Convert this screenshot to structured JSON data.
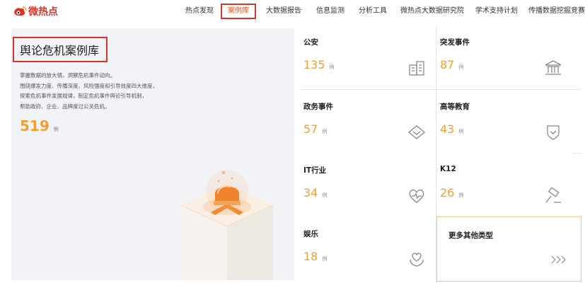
{
  "header": {
    "logo_text": "微热点",
    "nav": [
      "热点发现",
      "案例库",
      "大数据报告",
      "信息监测",
      "分析工具",
      "微热点大数据研究院",
      "学术支持计划",
      "传播数据挖掘竞赛"
    ],
    "active_index": 1
  },
  "left": {
    "title": "舆论危机案例库",
    "desc": [
      "掌握数据的放大镜，洞察危机事件动向。",
      "围绕爆发力度、传播深度、风险强度和引导效度四大维度，",
      "探索危机事件发展规律，制定危机事件舆论引导机制，",
      "帮助政府、企业、品牌度过公关危机。"
    ],
    "total": "519",
    "total_unit": "例"
  },
  "cards": [
    {
      "name": "公安",
      "count": "135",
      "unit": "例",
      "icon": "building-icon"
    },
    {
      "name": "突发事件",
      "count": "87",
      "unit": "例",
      "icon": "bank-icon"
    },
    {
      "name": "政务事件",
      "count": "57",
      "unit": "例",
      "icon": "diamond-chevron-icon"
    },
    {
      "name": "高等教育",
      "count": "43",
      "unit": "例",
      "icon": "shield-check-icon"
    },
    {
      "name": "IT行业",
      "count": "34",
      "unit": "例",
      "icon": "heart-pulse-icon"
    },
    {
      "name": "K12",
      "count": "26",
      "unit": "例",
      "icon": "hammer-icon"
    },
    {
      "name": "娱乐",
      "count": "18",
      "unit": "例",
      "icon": "heart-hands-icon"
    }
  ],
  "more": {
    "label": "更多其他类型",
    "icon": "triple-chevron-right-icon"
  },
  "colors": {
    "accent": "#f0a030",
    "brand": "#d8352a",
    "panel_bg": "#f2f3f6"
  }
}
